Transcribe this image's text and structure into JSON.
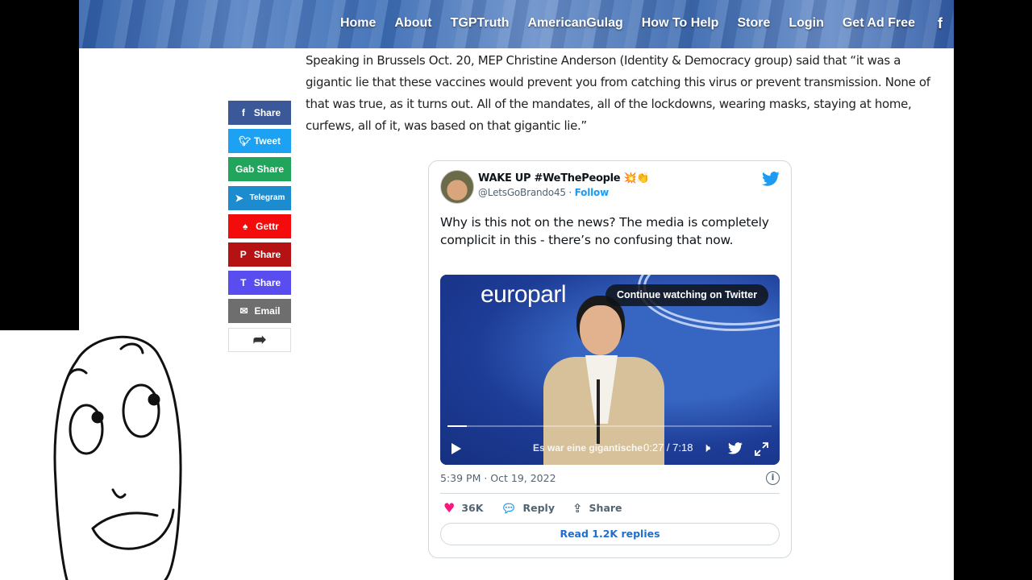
{
  "nav": {
    "items": [
      "Home",
      "About",
      "TGPTruth",
      "AmericanGulag",
      "How To Help",
      "Store",
      "Login",
      "Get Ad Free"
    ],
    "facebook_icon": "f"
  },
  "article": {
    "paragraph": "Speaking in Brussels Oct. 20, MEP Christine Anderson (Identity & Democracy group) said that “it was a gigantic lie that these vaccines would prevent you from catching this virus or prevent transmission. None of that was true, as it turns out. All of the mandates, all of the lockdowns, wearing masks, staying at home, curfews, all of it, was based on that gigantic lie.”"
  },
  "share_buttons": [
    {
      "label": "Share",
      "icon": "f",
      "color": "#3b5998"
    },
    {
      "label": "Tweet",
      "icon": "🐦",
      "color": "#1da1f2"
    },
    {
      "label": "Gab Share",
      "icon": "",
      "color": "#21a55c"
    },
    {
      "label": "Telegram",
      "icon": "➤",
      "color": "#1d8ccf"
    },
    {
      "label": "Gettr",
      "icon": "♠",
      "color": "#f40c0c"
    },
    {
      "label": "Share",
      "icon": "P",
      "color": "#b51313"
    },
    {
      "label": "Share",
      "icon": "T",
      "color": "#5a4df0"
    },
    {
      "label": "Email",
      "icon": "✉",
      "color": "#6e6e6e"
    }
  ],
  "more_share_icon": "➦",
  "tweet": {
    "name": "WAKE UP #WeThePeople 💥👏",
    "handle": "@LetsGoBrando45",
    "separator": " · ",
    "follow": "Follow",
    "text": "Why is this not on the news? The media is completely complicit in this - there’s no confusing that now.",
    "video": {
      "logo_text": "europarl",
      "continue_label": "Continue watching on Twitter",
      "subtitle": "Es war eine gigantische",
      "time": "0:27 / 7:18",
      "progress": 0.06
    },
    "date": "5:39 PM · Oct 19, 2022",
    "info_icon": "i",
    "likes": "36K",
    "reply": "Reply",
    "share": "Share",
    "read_replies": "Read 1.2K replies"
  },
  "colors": {
    "twitter_blue": "#1d9bf0",
    "like_pink": "#f91880",
    "header_blue": "#3d6bb0"
  }
}
